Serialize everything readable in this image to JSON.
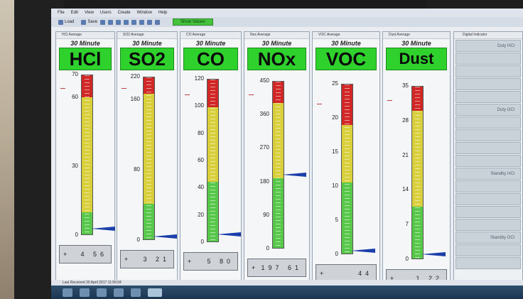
{
  "menu": [
    "File",
    "Edit",
    "View",
    "Users",
    "Create",
    "Window",
    "Help"
  ],
  "toolbar": {
    "load": "Load",
    "save": "Save",
    "status_button": "Show Values"
  },
  "panels": [
    {
      "title": "HCl Average",
      "avg": "30 Minute",
      "gas": "HCl",
      "ticks": [
        "70",
        "60",
        "30",
        "0"
      ],
      "readout_sign": "+",
      "readout": "4 56",
      "value_fraction": 0.04
    },
    {
      "title": "SO2 Average",
      "avg": "30 Minute",
      "gas": "SO2",
      "ticks": [
        "220",
        "160",
        "80",
        "0"
      ],
      "readout_sign": "+",
      "readout": "3 21",
      "value_fraction": 0.02
    },
    {
      "title": "CO Average",
      "avg": "30 Minute",
      "gas": "CO",
      "ticks": [
        "120",
        "100",
        "80",
        "60",
        "40",
        "20",
        "0"
      ],
      "readout_sign": "+",
      "readout": "5 80",
      "value_fraction": 0.05
    },
    {
      "title": "Nox Average",
      "avg": "30 Minute",
      "gas": "NOx",
      "ticks": [
        "450",
        "360",
        "270",
        "180",
        "90",
        "0"
      ],
      "readout_sign": "+",
      "readout": "197 61",
      "value_fraction": 0.44
    },
    {
      "title": "VOC Average",
      "avg": "30 Minute",
      "gas": "VOC",
      "ticks": [
        "25",
        "20",
        "15",
        "10",
        "5",
        "0"
      ],
      "readout_sign": "+",
      "readout": "44",
      "value_fraction": 0.02
    },
    {
      "title": "Dust Average",
      "avg": "30 Minute",
      "gas": "Dust",
      "ticks": [
        "35",
        "28",
        "21",
        "14",
        "7",
        "0"
      ],
      "readout_sign": "+",
      "readout": "1 22",
      "value_fraction": 0.03
    }
  ],
  "digital": {
    "title": "Digital Indicator",
    "rows": [
      "Duty HCl",
      "",
      "",
      "",
      "",
      "Duty OCl",
      "",
      "",
      "",
      "",
      "Standby HCl",
      "",
      "",
      "",
      "",
      "Standby OCl",
      "",
      ""
    ]
  },
  "statusbar": "Last Received 30 April 2017 11:56:04",
  "colors": {
    "green": "#58c84a",
    "yellow": "#d8cf3a",
    "red": "#d12727",
    "pointer": "#1b3fa8",
    "label_bg": "#2fd12c"
  }
}
